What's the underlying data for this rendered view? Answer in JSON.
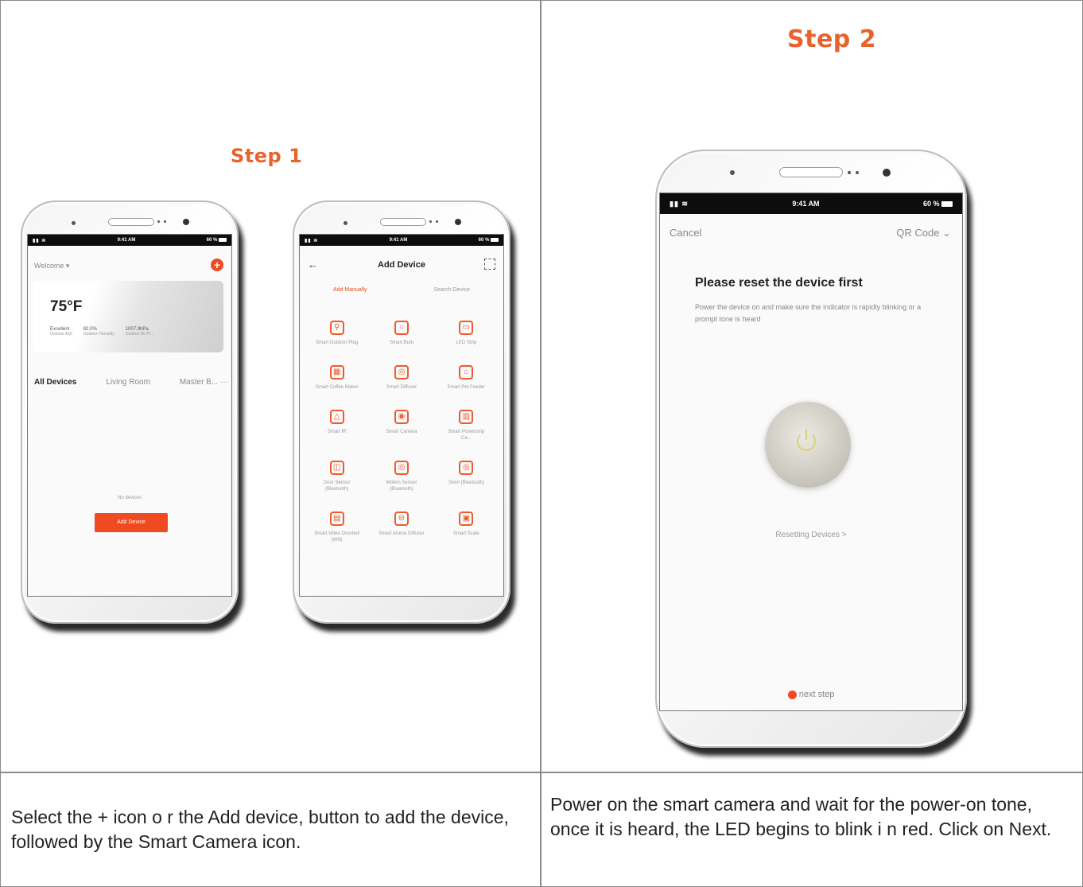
{
  "step1": {
    "title": "Step 1",
    "caption": "Select the + icon o r the Add device, button to add the device, followed by the Smart Camera icon."
  },
  "step2": {
    "title": "Step 2",
    "caption": "Power on the smart camera and wait for the power-on tone, once it is heard,  the LED begins to blink i n red. Click on Next."
  },
  "status": {
    "time": "9:41 AM",
    "battery": "60 %"
  },
  "phone_home": {
    "home_name": "Welcome",
    "temperature": "75°F",
    "weather": [
      {
        "value": "Excellent",
        "label": "Outdoor AQI"
      },
      {
        "value": "82.0%",
        "label": "Outdoor Humidity"
      },
      {
        "value": "1007.9hPa",
        "label": "Outdoor Air Pr..."
      }
    ],
    "rooms": [
      "All Devices",
      "Living Room",
      "Master B..."
    ],
    "more": "···",
    "empty_text": "No devices",
    "add_button": "Add Device"
  },
  "phone_add": {
    "title": "Add Device",
    "tabs": [
      "Add Manually",
      "Search Device"
    ],
    "devices": [
      {
        "icon": "⚲",
        "label": "Smart Outdoor Plug"
      },
      {
        "icon": "○",
        "label": "Smart Bulb"
      },
      {
        "icon": "▭",
        "label": "LED Strip"
      },
      {
        "icon": "▦",
        "label": "Smart Coffee Maker"
      },
      {
        "icon": "◎",
        "label": "Smart Diffuser"
      },
      {
        "icon": "⌂",
        "label": "Smart Pet Feeder"
      },
      {
        "icon": "△",
        "label": "Smart IR"
      },
      {
        "icon": "◉",
        "label": "Smart Camera"
      },
      {
        "icon": "▥",
        "label": "Smart Powerstrip Ca..."
      },
      {
        "icon": "◫",
        "label": "Door Sensor (Bluetooth)"
      },
      {
        "icon": "◎",
        "label": "Motion Sensor (Bluetooth)"
      },
      {
        "icon": "◎",
        "label": "Siren (Bluetooth)"
      },
      {
        "icon": "▤",
        "label": "Smart Video Doorbell (Wifi)"
      },
      {
        "icon": "⊖",
        "label": "Smart Aroma Diffuser"
      },
      {
        "icon": "▣",
        "label": "Smart Scale"
      }
    ]
  },
  "phone_reset": {
    "cancel": "Cancel",
    "qr": "QR Code",
    "heading": "Please reset the device first",
    "desc": "Power the device on and make sure the indicator is rapidly blinking or a prompt tone is heard",
    "resetting_link": "Resetting Devices >",
    "next": "next step"
  },
  "colors": {
    "accent": "#ef4a21",
    "title": "#e8622c"
  }
}
